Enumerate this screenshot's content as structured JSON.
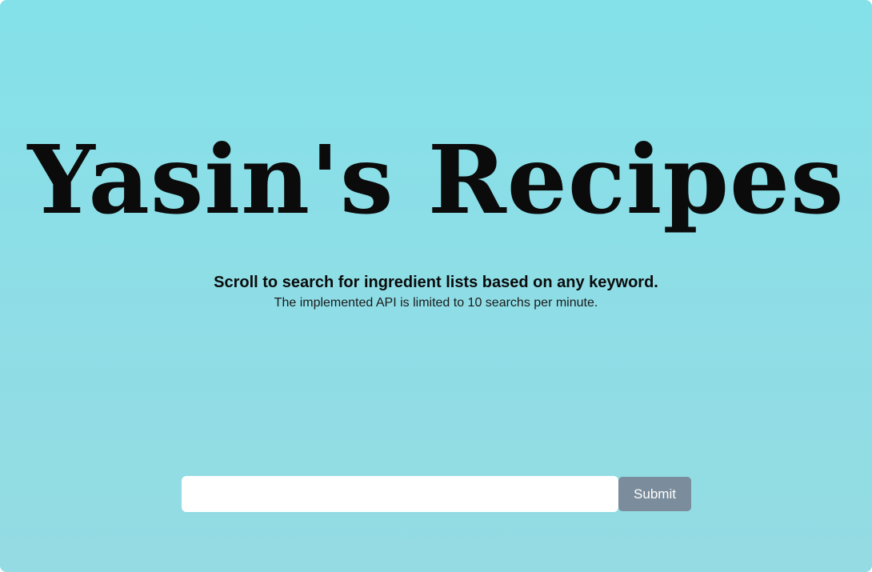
{
  "hero": {
    "title": "Yasin's Recipes",
    "tagline": "Scroll to search for ingredient lists based on any keyword.",
    "note": "The implemented API is limited to 10 searchs per minute."
  },
  "search": {
    "value": "",
    "placeholder": "",
    "submit_label": "Submit"
  },
  "colors": {
    "background": "#86e0e8",
    "button": "#7b8d9c",
    "text": "#0b0b0b"
  }
}
